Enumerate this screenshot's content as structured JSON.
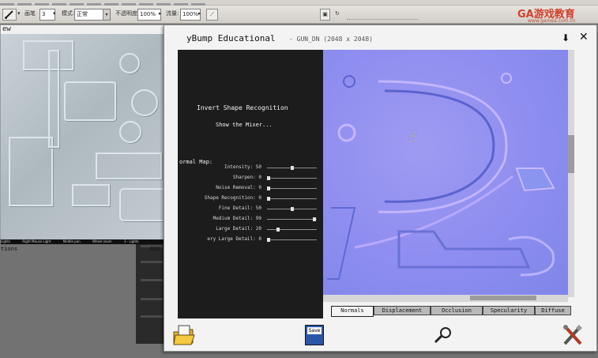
{
  "app": {
    "logo_text": "GA游戏教育",
    "logo_url": "www.gamea.com.cn"
  },
  "options_bar": {
    "brush_size": "3",
    "mode_label": "模式:",
    "mode_value": "正常",
    "opacity_label": "不透明度:",
    "opacity_value": "100%",
    "flow_label": "流量:",
    "flow_value": "100%",
    "brush_label": "画笔"
  },
  "preview": {
    "title": "ew",
    "status_items": [
      "Lights",
      "Right Mouse Light",
      "Middle pan",
      "Wheel zoom",
      "3 - Lights"
    ],
    "options_label": "tions",
    "box_label": "BOX"
  },
  "crazybump": {
    "title": "yBump Educational",
    "file": "- GUN_DN (2048 x 2048)",
    "invert_label": "Invert Shape Recognition",
    "mixer_label": "Show the Mixer...",
    "normal_map_label": "ormal Map:",
    "sliders": [
      {
        "label": "Intensity: 50",
        "value": 50
      },
      {
        "label": "Sharpen: 0",
        "value": 0
      },
      {
        "label": "Noise Removal: 0",
        "value": 0
      },
      {
        "label": "Shape Recognition: 0",
        "value": 0
      },
      {
        "label": "Fine Detail: 50",
        "value": 50
      },
      {
        "label": "Medium Detail: 99",
        "value": 99
      },
      {
        "label": "Large Detail: 20",
        "value": 20
      },
      {
        "label": "ery Large Detail: 0",
        "value": 0
      }
    ],
    "tabs": [
      "Normals",
      "Displacement",
      "Occlusion",
      "Specularity",
      "Diffuse"
    ],
    "active_tab": "Normals",
    "save_label": "Save"
  },
  "colors": {
    "normal_map_base": "#8e8df0",
    "logo_red": "#d3402b",
    "panel_dark": "#1c1c1c"
  }
}
